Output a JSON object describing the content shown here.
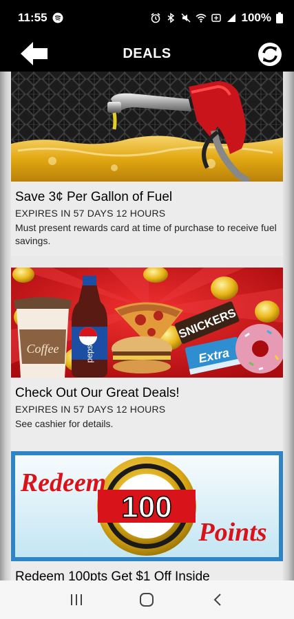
{
  "status": {
    "time": "11:55",
    "battery": "100%"
  },
  "header": {
    "title": "DEALS"
  },
  "deals": [
    {
      "title": "Save 3¢ Per Gallon of Fuel",
      "expiry": "EXPIRES IN 57 DAYS 12 HOURS",
      "description": "Must present rewards card at time of purchase to receive fuel savings."
    },
    {
      "title": "Check Out Our Great Deals!",
      "expiry": "EXPIRES IN 57 DAYS 12 HOURS",
      "description": "See cashier for details.",
      "image_text": {
        "coffee": "Coffee",
        "pepsi": "pepsi",
        "snickers": "SNICKERS",
        "extra": "Extra"
      }
    },
    {
      "title": "Redeem 100pts Get $1 Off Inside",
      "image_text": {
        "redeem": "Redeem",
        "number": "100",
        "points": "Points"
      }
    }
  ],
  "colors": {
    "accent_red": "#d8141a",
    "gold": "#e6b400",
    "background": "#000000"
  }
}
